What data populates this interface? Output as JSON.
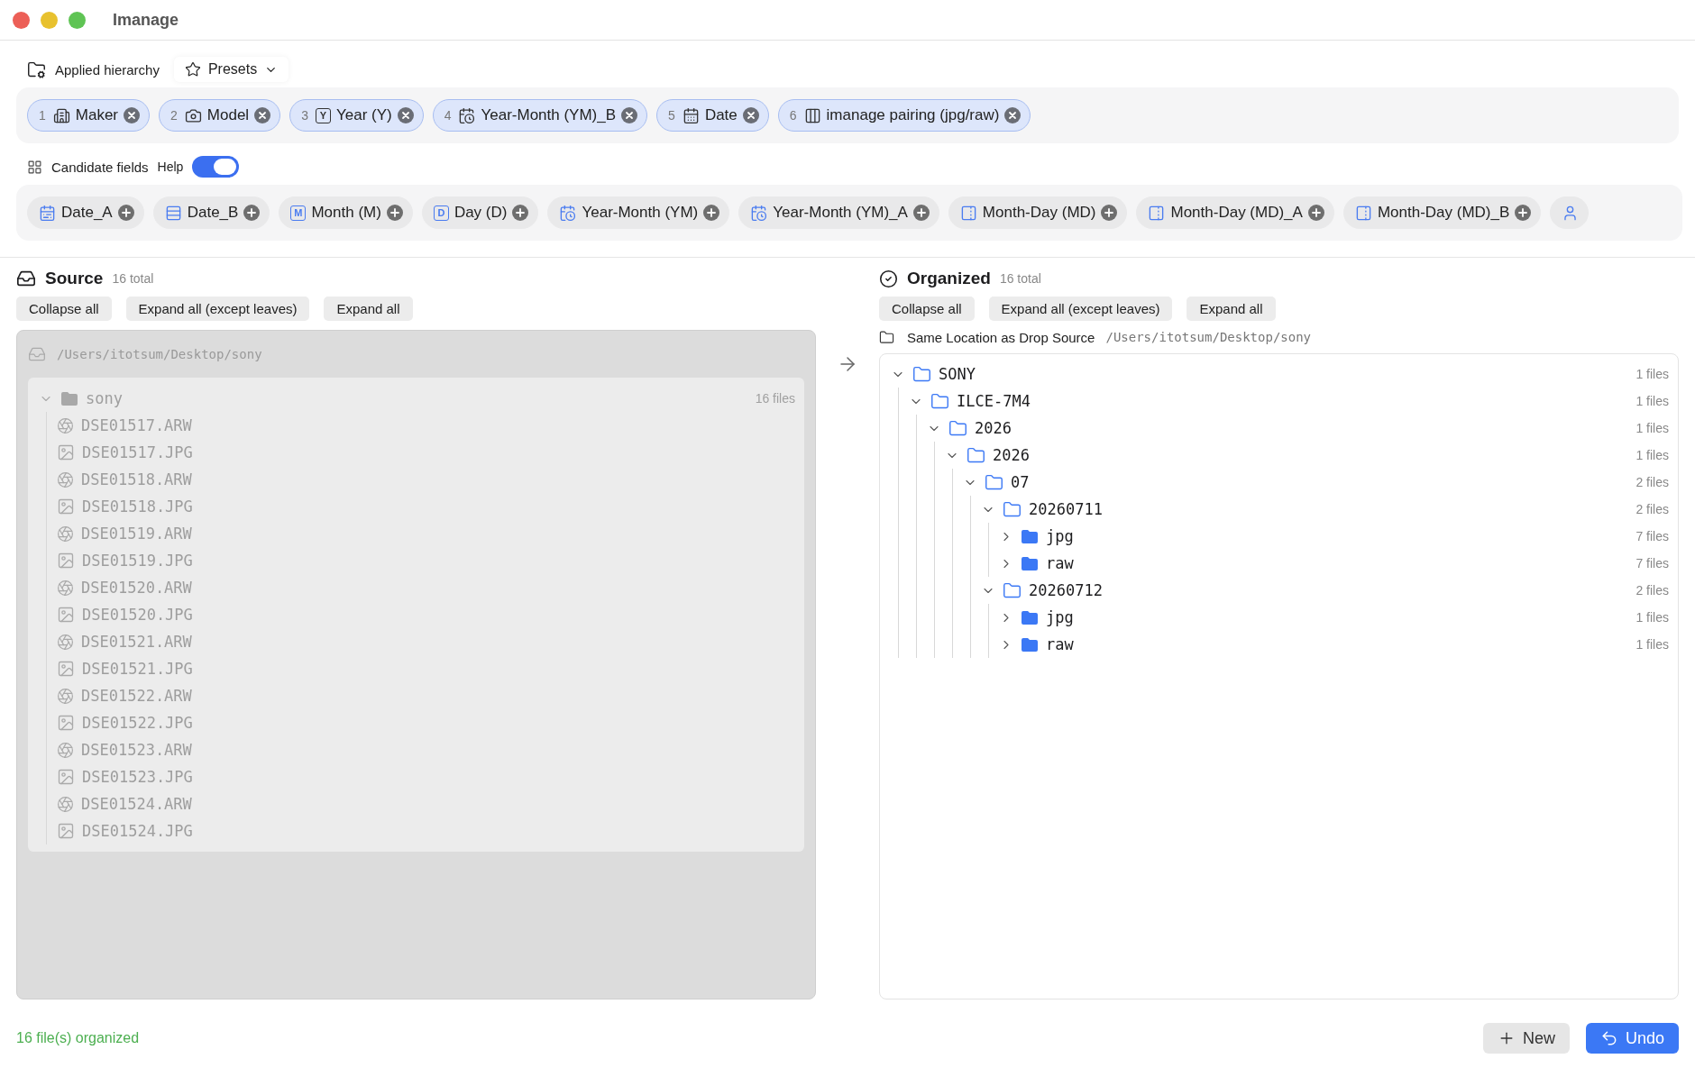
{
  "window": {
    "title": "Imanage"
  },
  "hierarchy": {
    "label": "Applied hierarchy",
    "presets_button": "Presets",
    "chips": [
      {
        "index": "1",
        "label": "Maker",
        "kind": "maker"
      },
      {
        "index": "2",
        "label": "Model",
        "kind": "model"
      },
      {
        "index": "3",
        "label": "Year (Y)",
        "kind": "letter",
        "glyph": "Y"
      },
      {
        "index": "4",
        "label": "Year-Month (YM)_B",
        "kind": "yearmonth"
      },
      {
        "index": "5",
        "label": "Date",
        "kind": "date"
      },
      {
        "index": "6",
        "label": "imanage pairing (jpg/raw)",
        "kind": "pairing"
      }
    ]
  },
  "candidates": {
    "label": "Candidate fields",
    "help_label": "Help",
    "help_on": true,
    "chips": [
      {
        "label": "Date_A",
        "kind": "dateround"
      },
      {
        "label": "Date_B",
        "kind": "range"
      },
      {
        "label": "Month (M)",
        "kind": "letter",
        "glyph": "M"
      },
      {
        "label": "Day (D)",
        "kind": "letter",
        "glyph": "D"
      },
      {
        "label": "Year-Month (YM)",
        "kind": "yearmonth"
      },
      {
        "label": "Year-Month (YM)_A",
        "kind": "yearmonth"
      },
      {
        "label": "Month-Day (MD)",
        "kind": "monthday"
      },
      {
        "label": "Month-Day (MD)_A",
        "kind": "monthday"
      },
      {
        "label": "Month-Day (MD)_B",
        "kind": "monthday"
      },
      {
        "kind": "person"
      }
    ]
  },
  "source": {
    "title": "Source",
    "total": "16 total",
    "buttons": [
      "Collapse all",
      "Expand all (except leaves)",
      "Expand all"
    ],
    "path": "/Users/itotsum/Desktop/sony",
    "tree": [
      {
        "name": "sony",
        "count": "16 files",
        "expanded": true,
        "children": [
          {
            "name": "DSE01517.ARW",
            "kind": "raw"
          },
          {
            "name": "DSE01517.JPG",
            "kind": "image"
          },
          {
            "name": "DSE01518.ARW",
            "kind": "raw"
          },
          {
            "name": "DSE01518.JPG",
            "kind": "image"
          },
          {
            "name": "DSE01519.ARW",
            "kind": "raw"
          },
          {
            "name": "DSE01519.JPG",
            "kind": "image"
          },
          {
            "name": "DSE01520.ARW",
            "kind": "raw"
          },
          {
            "name": "DSE01520.JPG",
            "kind": "image"
          },
          {
            "name": "DSE01521.ARW",
            "kind": "raw"
          },
          {
            "name": "DSE01521.JPG",
            "kind": "image"
          },
          {
            "name": "DSE01522.ARW",
            "kind": "raw"
          },
          {
            "name": "DSE01522.JPG",
            "kind": "image"
          },
          {
            "name": "DSE01523.ARW",
            "kind": "raw"
          },
          {
            "name": "DSE01523.JPG",
            "kind": "image"
          },
          {
            "name": "DSE01524.ARW",
            "kind": "raw"
          },
          {
            "name": "DSE01524.JPG",
            "kind": "image"
          }
        ]
      }
    ]
  },
  "organized": {
    "title": "Organized",
    "total": "16 total",
    "buttons": [
      "Collapse all",
      "Expand all (except leaves)",
      "Expand all"
    ],
    "location_label": "Same Location as Drop Source",
    "path": "/Users/itotsum/Desktop/sony",
    "tree": [
      {
        "name": "SONY",
        "count": "1 files",
        "expanded": true,
        "children": [
          {
            "name": "ILCE-7M4",
            "count": "1 files",
            "expanded": true,
            "children": [
              {
                "name": "2026",
                "count": "1 files",
                "expanded": true,
                "children": [
                  {
                    "name": "2026",
                    "count": "1 files",
                    "expanded": true,
                    "children": [
                      {
                        "name": "07",
                        "count": "2 files",
                        "expanded": true,
                        "children": [
                          {
                            "name": "20260711",
                            "count": "2 files",
                            "expanded": true,
                            "children": [
                              {
                                "name": "jpg",
                                "count": "7 files",
                                "expanded": false
                              },
                              {
                                "name": "raw",
                                "count": "7 files",
                                "expanded": false
                              }
                            ]
                          },
                          {
                            "name": "20260712",
                            "count": "2 files",
                            "expanded": true,
                            "children": [
                              {
                                "name": "jpg",
                                "count": "1 files",
                                "expanded": false
                              },
                              {
                                "name": "raw",
                                "count": "1 files",
                                "expanded": false
                              }
                            ]
                          }
                        ]
                      }
                    ]
                  }
                ]
              }
            ]
          }
        ]
      }
    ]
  },
  "status_bar": {
    "message": "16 file(s) organized",
    "new_button": "New",
    "undo_button": "Undo"
  }
}
